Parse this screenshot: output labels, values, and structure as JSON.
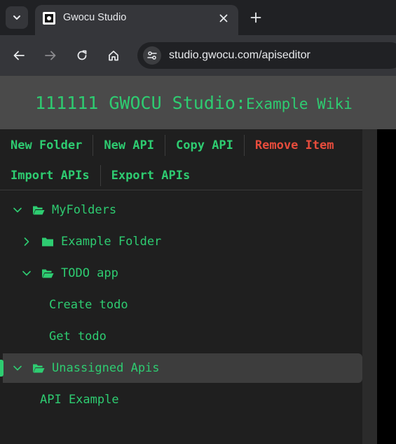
{
  "browser": {
    "tab_title": "Gwocu Studio",
    "url": "studio.gwocu.com/apiseditor"
  },
  "header": {
    "title_main": "111111 GWOCU Studio:",
    "title_sub": "Example Wiki"
  },
  "menu": {
    "new_folder": "New Folder",
    "new_api": "New API",
    "copy_api": "Copy API",
    "remove_item": "Remove Item",
    "import_apis": "Import APIs",
    "export_apis": "Export APIs"
  },
  "tree": {
    "root": "MyFolders",
    "example_folder": "Example Folder",
    "todo_folder": "TODO app",
    "todo_items": [
      "Create todo",
      "Get todo"
    ],
    "unassigned": "Unassigned Apis",
    "unassigned_items": [
      "API Example"
    ]
  },
  "colors": {
    "accent": "#2ecc71",
    "danger": "#e74c3c",
    "header_bg": "#4a4a4a",
    "panel_bg": "#1f1f1f"
  }
}
